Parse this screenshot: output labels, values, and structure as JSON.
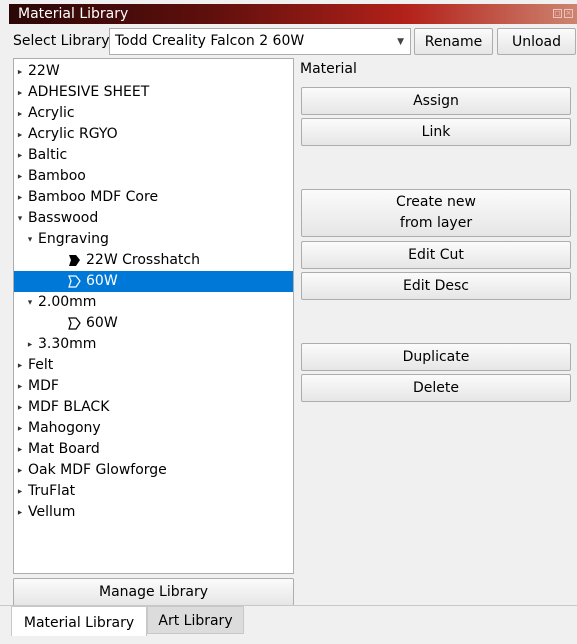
{
  "window": {
    "title": "Material Library"
  },
  "header": {
    "select_label": "Select Library",
    "library_value": "Todd Creality Falcon 2 60W",
    "rename_label": "Rename",
    "unload_label": "Unload"
  },
  "tree": {
    "items": [
      {
        "label": "22W",
        "expander": "collapsed",
        "icon": ""
      },
      {
        "label": "ADHESIVE SHEET",
        "expander": "collapsed",
        "icon": ""
      },
      {
        "label": "Acrylic",
        "expander": "collapsed",
        "icon": ""
      },
      {
        "label": "Acrylic RGYO",
        "expander": "collapsed",
        "icon": ""
      },
      {
        "label": "Baltic",
        "expander": "collapsed",
        "icon": ""
      },
      {
        "label": "Bamboo",
        "expander": "collapsed",
        "icon": ""
      },
      {
        "label": "Bamboo MDF Core",
        "expander": "collapsed",
        "icon": ""
      },
      {
        "label": "Basswood",
        "expander": "expanded",
        "icon": ""
      },
      {
        "label": "Engraving",
        "expander": "expanded",
        "icon": ""
      },
      {
        "label": "22W Crosshatch",
        "expander": "none",
        "icon": "fill-shape-icon"
      },
      {
        "label": "60W",
        "expander": "none",
        "icon": "outline-shape-icon",
        "selected": true
      },
      {
        "label": "2.00mm",
        "expander": "expanded",
        "icon": ""
      },
      {
        "label": "60W",
        "expander": "none",
        "icon": "outline-shape-icon"
      },
      {
        "label": "3.30mm",
        "expander": "collapsed",
        "icon": ""
      },
      {
        "label": "Felt",
        "expander": "collapsed",
        "icon": ""
      },
      {
        "label": "MDF",
        "expander": "collapsed",
        "icon": ""
      },
      {
        "label": "MDF BLACK",
        "expander": "collapsed",
        "icon": ""
      },
      {
        "label": "Mahogony",
        "expander": "collapsed",
        "icon": ""
      },
      {
        "label": "Mat Board",
        "expander": "collapsed",
        "icon": ""
      },
      {
        "label": "Oak MDF Glowforge",
        "expander": "collapsed",
        "icon": ""
      },
      {
        "label": "TruFlat",
        "expander": "collapsed",
        "icon": ""
      },
      {
        "label": "Vellum",
        "expander": "collapsed",
        "icon": ""
      }
    ],
    "selection_color": "#0078d7"
  },
  "material_panel": {
    "heading": "Material",
    "assign_label": "Assign",
    "link_label": "Link",
    "create_line1": "Create new",
    "create_line2": "from layer",
    "edit_cut_label": "Edit Cut",
    "edit_desc_label": "Edit Desc",
    "duplicate_label": "Duplicate",
    "delete_label": "Delete"
  },
  "footer": {
    "manage_label": "Manage Library",
    "tabs": [
      {
        "label": "Material Library",
        "active": true
      },
      {
        "label": "Art Library",
        "active": false
      }
    ]
  }
}
